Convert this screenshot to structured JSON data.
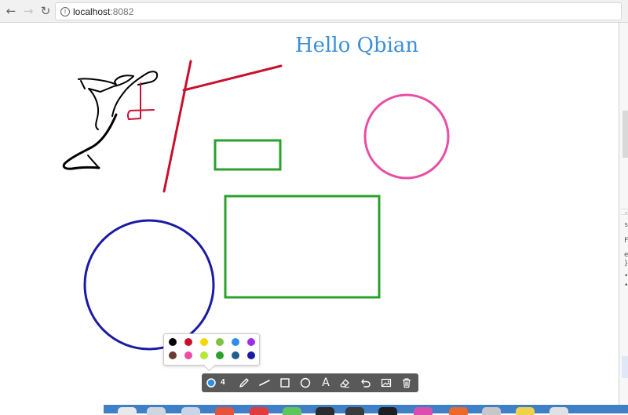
{
  "browser": {
    "back_icon": "arrow-left-icon",
    "forward_icon": "arrow-right-icon",
    "reload_icon": "reload-icon",
    "info_icon": "info-icon",
    "url_host": "localhost",
    "url_port": ":8082"
  },
  "canvas": {
    "text_annotation": "Hello Qbian",
    "text_color": "#3d8fd6"
  },
  "palette": {
    "colors": [
      "#000000",
      "#c8102e",
      "#f5d60a",
      "#7dc242",
      "#2f8ee5",
      "#9b30e8",
      "#6b3a30",
      "#e84ea3",
      "#b6e63a",
      "#2ca02c",
      "#1f5f8b",
      "#1a1aa6"
    ]
  },
  "toolbar": {
    "brush_size": "4",
    "tools": [
      "color-picker",
      "pencil",
      "line",
      "rectangle",
      "circle",
      "text",
      "eraser",
      "undo",
      "image",
      "trash"
    ]
  },
  "devtools": {
    "snippets": [
      "..",
      "s",
      "F",
      "e",
      "}",
      "•",
      "•"
    ]
  }
}
